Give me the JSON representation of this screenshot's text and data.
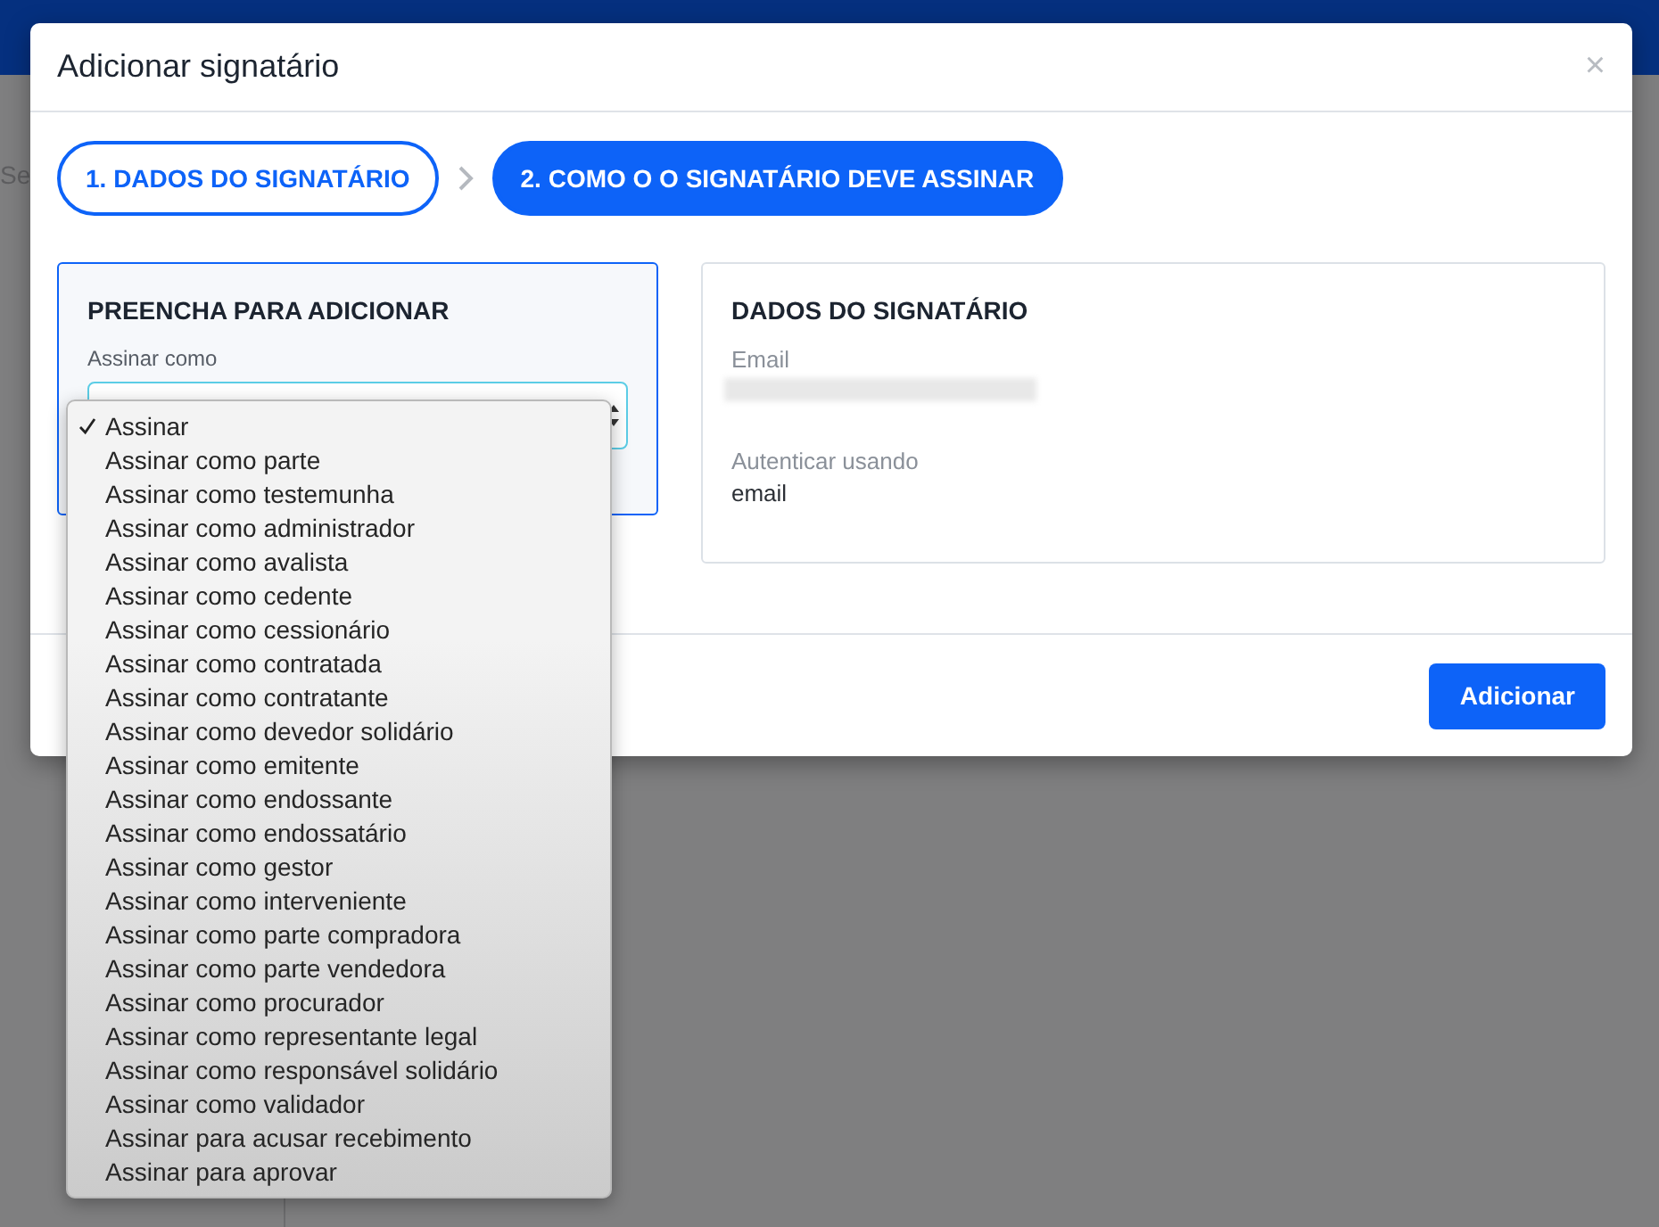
{
  "background": {
    "partial_label": "Se"
  },
  "dialog": {
    "title": "Adicionar signatário",
    "close": "×"
  },
  "steps": [
    {
      "label": "1. DADOS DO SIGNATÁRIO",
      "selected": false
    },
    {
      "label": "2. COMO O O SIGNATÁRIO DEVE ASSINAR",
      "selected": true
    }
  ],
  "form_card": {
    "title": "PREENCHA PARA ADICIONAR",
    "field_label": "Assinar como"
  },
  "dropdown": {
    "options": [
      {
        "label": "Assinar",
        "selected": true
      },
      {
        "label": "Assinar como parte",
        "selected": false
      },
      {
        "label": "Assinar como testemunha",
        "selected": false
      },
      {
        "label": "Assinar como administrador",
        "selected": false
      },
      {
        "label": "Assinar como avalista",
        "selected": false
      },
      {
        "label": "Assinar como cedente",
        "selected": false
      },
      {
        "label": "Assinar como cessionário",
        "selected": false
      },
      {
        "label": "Assinar como contratada",
        "selected": false
      },
      {
        "label": "Assinar como contratante",
        "selected": false
      },
      {
        "label": "Assinar como devedor solidário",
        "selected": false
      },
      {
        "label": "Assinar como emitente",
        "selected": false
      },
      {
        "label": "Assinar como endossante",
        "selected": false
      },
      {
        "label": "Assinar como endossatário",
        "selected": false
      },
      {
        "label": "Assinar como gestor",
        "selected": false
      },
      {
        "label": "Assinar como interveniente",
        "selected": false
      },
      {
        "label": "Assinar como parte compradora",
        "selected": false
      },
      {
        "label": "Assinar como parte vendedora",
        "selected": false
      },
      {
        "label": "Assinar como procurador",
        "selected": false
      },
      {
        "label": "Assinar como representante legal",
        "selected": false
      },
      {
        "label": "Assinar como responsável solidário",
        "selected": false
      },
      {
        "label": "Assinar como validador",
        "selected": false
      },
      {
        "label": "Assinar para acusar recebimento",
        "selected": false
      },
      {
        "label": "Assinar para aprovar",
        "selected": false
      }
    ]
  },
  "signer_card": {
    "title": "DADOS DO SIGNATÁRIO",
    "fields": [
      {
        "label": "Email",
        "kind": "redacted"
      },
      {
        "label": "Autenticar usando",
        "kind": "text",
        "value": "email"
      }
    ]
  },
  "footer": {
    "button": "Adicionar"
  }
}
